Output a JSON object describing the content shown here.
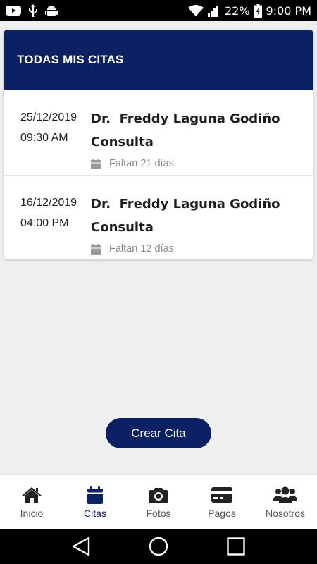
{
  "status_bar": {
    "battery": "22%",
    "time": "9:00 PM",
    "icons": [
      "youtube-icon",
      "usb-icon",
      "android-icon",
      "wifi-icon",
      "signal-icon",
      "battery-icon"
    ]
  },
  "card": {
    "title": "TODAS MIS CITAS",
    "appointments": [
      {
        "date": "25/12/2019",
        "time": "09:30 AM",
        "doctor": "Dr.  Freddy Laguna Godiño",
        "type": "Consulta",
        "remaining": "Faltan 21 días"
      },
      {
        "date": "16/12/2019",
        "time": "04:00 PM",
        "doctor": "Dr.  Freddy Laguna Godiño",
        "type": "Consulta",
        "remaining": "Faltan 12 días"
      }
    ]
  },
  "create_button": {
    "label": "Crear Cita"
  },
  "bottom_nav": {
    "active": "Citas",
    "items": [
      {
        "label": "Inicio",
        "icon": "home-icon"
      },
      {
        "label": "Citas",
        "icon": "calendar-icon"
      },
      {
        "label": "Fotos",
        "icon": "camera-icon"
      },
      {
        "label": "Pagos",
        "icon": "credit-card-icon"
      },
      {
        "label": "Nosotros",
        "icon": "users-icon"
      }
    ]
  },
  "colors": {
    "primary": "#0b2163",
    "background": "#efefef",
    "muted_text": "#8a8a8a"
  }
}
